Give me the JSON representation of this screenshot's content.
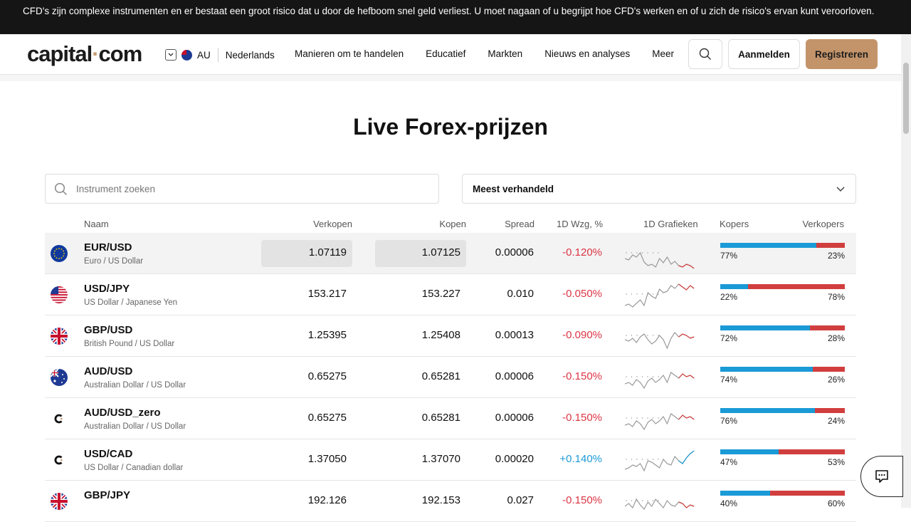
{
  "banner": {
    "text": "CFD's zijn complexe instrumenten en er bestaat een groot risico dat u door de hefboom snel geld verliest. U moet nagaan of u begrijpt hoe CFD's werken en of u zich de risico's ervan kunt veroorloven."
  },
  "header": {
    "logo_left": "capital",
    "logo_dot": "·",
    "logo_right": "com",
    "region": "AU",
    "language": "Nederlands",
    "nav": [
      "Manieren om te handelen",
      "Educatief",
      "Markten",
      "Nieuws en analyses",
      "Meer"
    ],
    "login": "Aanmelden",
    "register": "Registreren"
  },
  "main": {
    "title": "Live Forex-prijzen",
    "search_placeholder": "Instrument zoeken",
    "sort_value": "Meest verhandeld",
    "columns": {
      "name": "Naam",
      "sell": "Verkopen",
      "buy": "Kopen",
      "spread": "Spread",
      "change": "1D Wzg, %",
      "charts": "1D Grafieken",
      "buyers": "Kopers",
      "sellers": "Verkopers"
    },
    "rows": [
      {
        "name": "EUR/USD",
        "sub": "Euro / US Dollar",
        "flag": "eu-flag-icon",
        "sell": "1.07119",
        "buy": "1.07125",
        "spread": "0.00006",
        "change": "-0.120%",
        "buyers_pct": "77%",
        "sellers_pct": "23%",
        "buyers": 77
      },
      {
        "name": "USD/JPY",
        "sub": "US Dollar / Japanese Yen",
        "flag": "us-flag-icon",
        "sell": "153.217",
        "buy": "153.227",
        "spread": "0.010",
        "change": "-0.050%",
        "buyers_pct": "22%",
        "sellers_pct": "78%",
        "buyers": 22
      },
      {
        "name": "GBP/USD",
        "sub": "British Pound / US Dollar",
        "flag": "uk-flag-icon",
        "sell": "1.25395",
        "buy": "1.25408",
        "spread": "0.00013",
        "change": "-0.090%",
        "buyers_pct": "72%",
        "sellers_pct": "28%",
        "buyers": 72
      },
      {
        "name": "AUD/USD",
        "sub": "Australian Dollar / US Dollar",
        "flag": "au-flag-icon",
        "sell": "0.65275",
        "buy": "0.65281",
        "spread": "0.00006",
        "change": "-0.150%",
        "buyers_pct": "74%",
        "sellers_pct": "26%",
        "buyers": 74
      },
      {
        "name": "AUD/USD_zero",
        "sub": "Australian Dollar / US Dollar",
        "flag": "capital-logo-icon",
        "sell": "0.65275",
        "buy": "0.65281",
        "spread": "0.00006",
        "change": "-0.150%",
        "buyers_pct": "76%",
        "sellers_pct": "24%",
        "buyers": 76
      },
      {
        "name": "USD/CAD",
        "sub": "US Dollar / Canadian dollar",
        "flag": "capital-logo-icon",
        "sell": "1.37050",
        "buy": "1.37070",
        "spread": "0.00020",
        "change": "+0.140%",
        "buyers_pct": "47%",
        "sellers_pct": "53%",
        "buyers": 47
      },
      {
        "name": "GBP/JPY",
        "sub": "",
        "flag": "uk-flag-icon",
        "sell": "192.126",
        "buy": "192.153",
        "spread": "0.027",
        "change": "-0.150%",
        "buyers_pct": "40%",
        "sellers_pct": "60%",
        "buyers": 40
      }
    ]
  },
  "colors": {
    "buy": "#1a9ad6",
    "sell": "#d13e3e",
    "negative": "#dc3545",
    "positive": "#1e9ad6",
    "accent": "#c3946a"
  },
  "icons": [
    "search-icon",
    "chevron-down-icon",
    "chat-icon"
  ]
}
